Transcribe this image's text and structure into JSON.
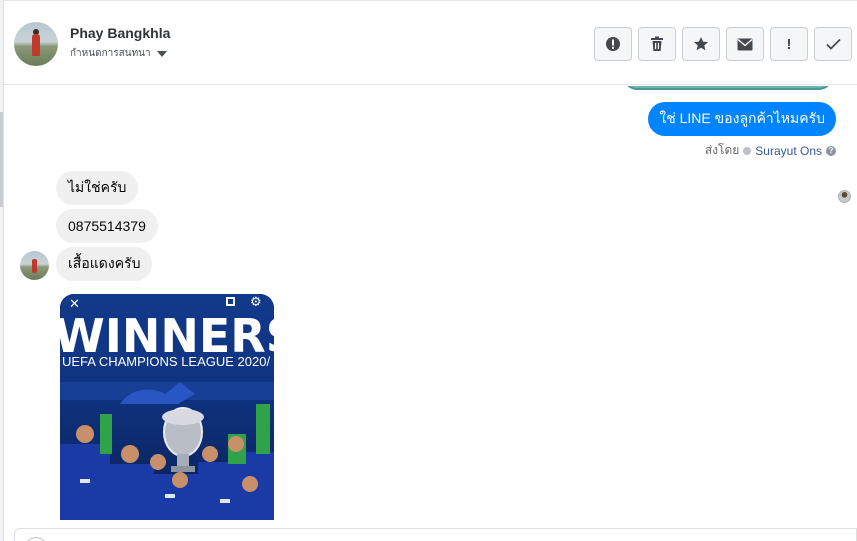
{
  "contact": {
    "name": "Phay Bangkhla",
    "status": "กำหนดการสนทนา"
  },
  "actions": [
    {
      "name": "spam-icon",
      "glyph": ""
    },
    {
      "name": "trash-icon",
      "glyph": ""
    },
    {
      "name": "star-icon",
      "glyph": ""
    },
    {
      "name": "mail-icon",
      "glyph": ""
    },
    {
      "name": "exclamation-icon",
      "glyph": "!"
    },
    {
      "name": "check-icon",
      "glyph": ""
    }
  ],
  "thread": {
    "outgoing": {
      "text": "ใช่ LINE ของลูกค้าไหมครับ",
      "sent_by_label": "ส่งโดย",
      "agent": "Surayut Ons",
      "help_glyph": "?"
    },
    "incoming": [
      {
        "text": "ไม่ใช่ครับ"
      },
      {
        "text": "0875514379"
      },
      {
        "text": "เสื้อแดงครับ"
      }
    ],
    "image": {
      "banner_line1": "WINNERS",
      "banner_line2": "UEFA CHAMPIONS LEAGUE 2020/",
      "close_glyph": "✕",
      "settings_glyph": "⚙"
    }
  },
  "colors": {
    "outgoing_bubble": "#0084ff",
    "incoming_bubble": "#f0f0f0",
    "agent_link": "#385898"
  }
}
